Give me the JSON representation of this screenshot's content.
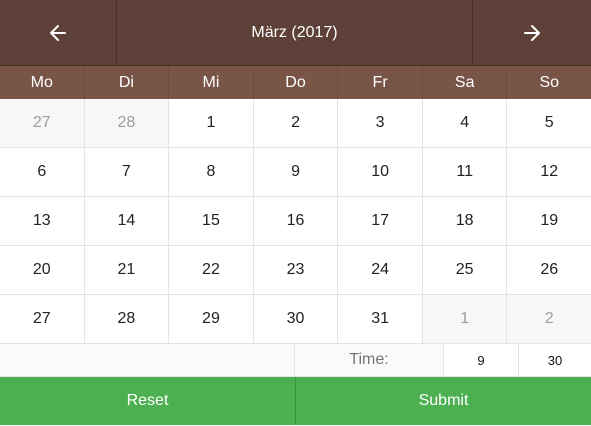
{
  "header": {
    "title": "März (2017)",
    "prev_icon": "arrow-left-icon",
    "next_icon": "arrow-right-icon"
  },
  "weekdays": [
    "Mo",
    "Di",
    "Mi",
    "Do",
    "Fr",
    "Sa",
    "So"
  ],
  "weeks": [
    [
      {
        "d": "27",
        "other": true
      },
      {
        "d": "28",
        "other": true
      },
      {
        "d": "1"
      },
      {
        "d": "2"
      },
      {
        "d": "3"
      },
      {
        "d": "4"
      },
      {
        "d": "5"
      }
    ],
    [
      {
        "d": "6"
      },
      {
        "d": "7"
      },
      {
        "d": "8"
      },
      {
        "d": "9"
      },
      {
        "d": "10"
      },
      {
        "d": "11"
      },
      {
        "d": "12"
      }
    ],
    [
      {
        "d": "13"
      },
      {
        "d": "14"
      },
      {
        "d": "15"
      },
      {
        "d": "16"
      },
      {
        "d": "17"
      },
      {
        "d": "18"
      },
      {
        "d": "19"
      }
    ],
    [
      {
        "d": "20"
      },
      {
        "d": "21"
      },
      {
        "d": "22"
      },
      {
        "d": "23"
      },
      {
        "d": "24"
      },
      {
        "d": "25"
      },
      {
        "d": "26"
      }
    ],
    [
      {
        "d": "27"
      },
      {
        "d": "28"
      },
      {
        "d": "29"
      },
      {
        "d": "30"
      },
      {
        "d": "31"
      },
      {
        "d": "1",
        "other": true
      },
      {
        "d": "2",
        "other": true
      }
    ]
  ],
  "time": {
    "label": "Time:",
    "hour": "9",
    "minute": "30"
  },
  "actions": {
    "reset_label": "Reset",
    "submit_label": "Submit"
  },
  "colors": {
    "header_bg": "#5d4037",
    "weekday_bg": "#795548",
    "button_bg": "#4caf50"
  }
}
